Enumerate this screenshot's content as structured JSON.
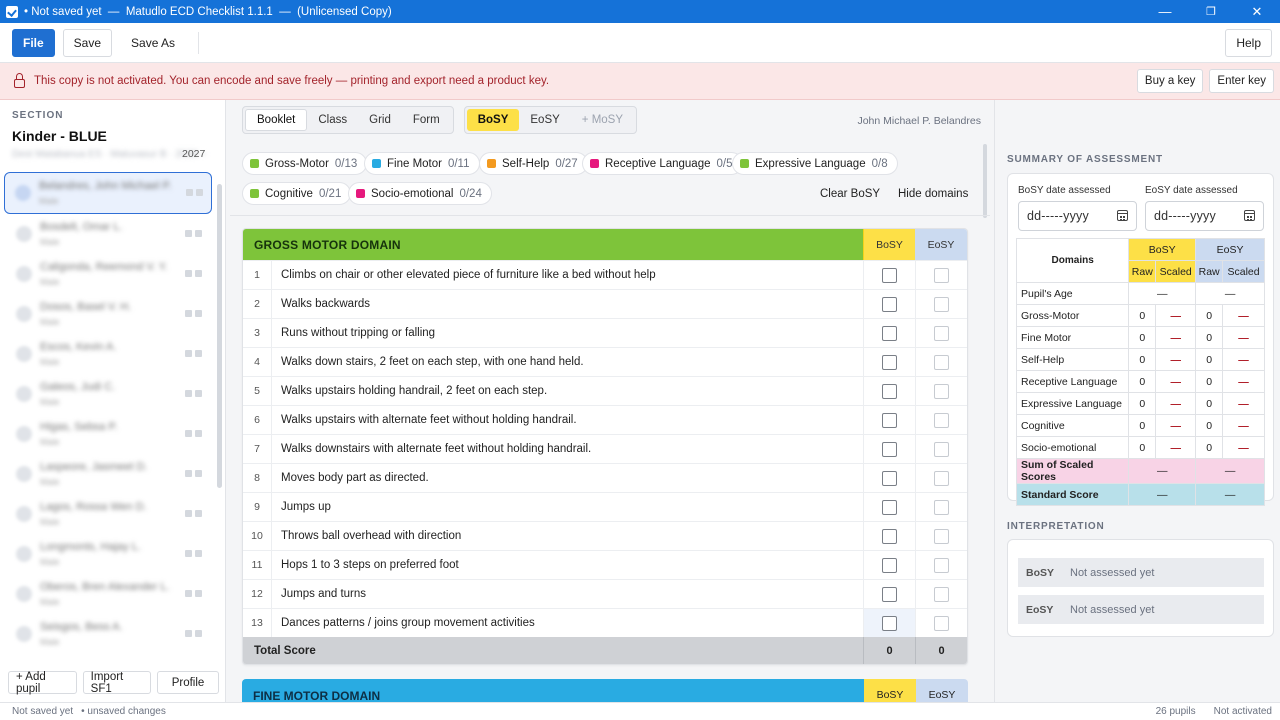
{
  "titlebar": {
    "title": "• Not saved yet  —  Matudlo ECD Checklist 1.1.1  —  (Unlicensed Copy)",
    "minimize": "—",
    "maximize": "❐",
    "close": "✕"
  },
  "menubar": {
    "file": "File",
    "save": "Save",
    "save_as": "Save As",
    "help": "Help"
  },
  "banner": {
    "message": "This copy is not activated. You can encode and save freely — printing and export need a product key.",
    "buy_key": "Buy a key",
    "enter_key": "Enter key"
  },
  "sidebar": {
    "section_label": "SECTION",
    "section_name": "Kinder - BLUE",
    "section_meta": "Dest Matabanua ES · Matuvasur B · 2026 –",
    "year": "2027",
    "pupils": [
      {
        "name": "Belandres, John Michael P.",
        "sub": "Male"
      },
      {
        "name": "Bosdelt, Omar L.",
        "sub": "Male"
      },
      {
        "name": "Caligonda, Reemond V. Y.",
        "sub": "Male"
      },
      {
        "name": "Dosos, Basel V. H.",
        "sub": "Male"
      },
      {
        "name": "Escos, Kevin A.",
        "sub": "Male"
      },
      {
        "name": "Galeos, Judi C.",
        "sub": "Male"
      },
      {
        "name": "Higas, Sebsa P.",
        "sub": "Male"
      },
      {
        "name": "Laspeore, Jasmeet D.",
        "sub": "Male"
      },
      {
        "name": "Lagos, Rossa Wen D.",
        "sub": "Male"
      },
      {
        "name": "Longmonts, Hajay L.",
        "sub": "Male"
      },
      {
        "name": "Oberos, Bren Alexander L.",
        "sub": "Male"
      },
      {
        "name": "Seisgos, Bess A.",
        "sub": "Male"
      }
    ],
    "add_pupil": "+ Add pupil",
    "import_sf1": "Import SF1",
    "profile": "Profile"
  },
  "main": {
    "views": [
      "Booklet",
      "Class",
      "Grid",
      "Form"
    ],
    "active_view": "Booklet",
    "terms": [
      "BoSY",
      "EoSY",
      "+ MoSY"
    ],
    "active_term": "BoSY",
    "assessor": "John Michael P. Belandres",
    "domain_chips": [
      {
        "label": "Gross-Motor",
        "count": "0/13",
        "color": "#7ec43a"
      },
      {
        "label": "Fine Motor",
        "count": "0/11",
        "color": "#29abe2"
      },
      {
        "label": "Self-Help",
        "count": "0/27",
        "color": "#f39a1f"
      },
      {
        "label": "Receptive Language",
        "count": "0/5",
        "color": "#e6197d"
      },
      {
        "label": "Expressive Language",
        "count": "0/8",
        "color": "#7ec43a"
      },
      {
        "label": "Cognitive",
        "count": "0/21",
        "color": "#7ec43a"
      },
      {
        "label": "Socio-emotional",
        "count": "0/24",
        "color": "#e6197d"
      }
    ],
    "clear_bosy": "Clear BoSY",
    "hide_domains": "Hide domains",
    "gross_motor": {
      "title": "GROSS MOTOR DOMAIN",
      "col_bosy": "BoSY",
      "col_eosy": "EoSY",
      "items": [
        "Climbs on chair or other elevated piece of furniture like a bed without help",
        "Walks backwards",
        "Runs without tripping or falling",
        "Walks down stairs, 2 feet on each step, with one hand held.",
        "Walks upstairs holding handrail, 2 feet on each step.",
        "Walks upstairs with alternate feet without holding handrail.",
        "Walks downstairs with alternate feet without holding handrail.",
        "Moves body part as directed.",
        "Jumps up",
        "Throws ball overhead with direction",
        "Hops 1 to 3 steps on preferred foot",
        "Jumps and turns",
        "Dances patterns / joins group movement activities"
      ],
      "numbers": [
        "1",
        "2",
        "3",
        "4",
        "5",
        "6",
        "7",
        "8",
        "9",
        "10",
        "11",
        "12",
        "13"
      ],
      "total_label": "Total Score",
      "total_bosy": "0",
      "total_eosy": "0"
    },
    "fine_motor": {
      "title": "FINE MOTOR DOMAIN",
      "col_bosy": "BoSY",
      "col_eosy": "EoSY"
    }
  },
  "summary": {
    "label": "SUMMARY OF ASSESSMENT",
    "bosy_date_label": "BoSY date assessed",
    "eosy_date_label": "EoSY date assessed",
    "date_placeholder": "dd-----yyyy",
    "col_domains": "Domains",
    "col_bosy": "BoSY",
    "col_eosy": "EoSY",
    "col_raw": "Raw",
    "col_scaled": "Scaled",
    "age_label": "Pupil's Age",
    "age_bosy": "—",
    "age_eosy": "—",
    "rows": [
      {
        "name": "Gross-Motor",
        "b_raw": "0",
        "b_scaled": "—",
        "e_raw": "0",
        "e_scaled": "—"
      },
      {
        "name": "Fine Motor",
        "b_raw": "0",
        "b_scaled": "—",
        "e_raw": "0",
        "e_scaled": "—"
      },
      {
        "name": "Self-Help",
        "b_raw": "0",
        "b_scaled": "—",
        "e_raw": "0",
        "e_scaled": "—"
      },
      {
        "name": "Receptive Language",
        "b_raw": "0",
        "b_scaled": "—",
        "e_raw": "0",
        "e_scaled": "—"
      },
      {
        "name": "Expressive Language",
        "b_raw": "0",
        "b_scaled": "—",
        "e_raw": "0",
        "e_scaled": "—"
      },
      {
        "name": "Cognitive",
        "b_raw": "0",
        "b_scaled": "—",
        "e_raw": "0",
        "e_scaled": "—"
      },
      {
        "name": "Socio-emotional",
        "b_raw": "0",
        "b_scaled": "—",
        "e_raw": "0",
        "e_scaled": "—"
      }
    ],
    "sum_label": "Sum of Scaled Scores",
    "sum_bosy": "—",
    "sum_eosy": "—",
    "std_label": "Standard Score",
    "std_bosy": "—",
    "std_eosy": "—"
  },
  "interpretation": {
    "label": "INTERPRETATION",
    "bosy_key": "BoSY",
    "bosy_value": "Not assessed yet",
    "eosy_key": "EoSY",
    "eosy_value": "Not assessed yet"
  },
  "statusbar": {
    "save_state": "Not saved yet",
    "changes": "• unsaved changes",
    "pupil_count": "26 pupils",
    "activation": "Not activated"
  }
}
